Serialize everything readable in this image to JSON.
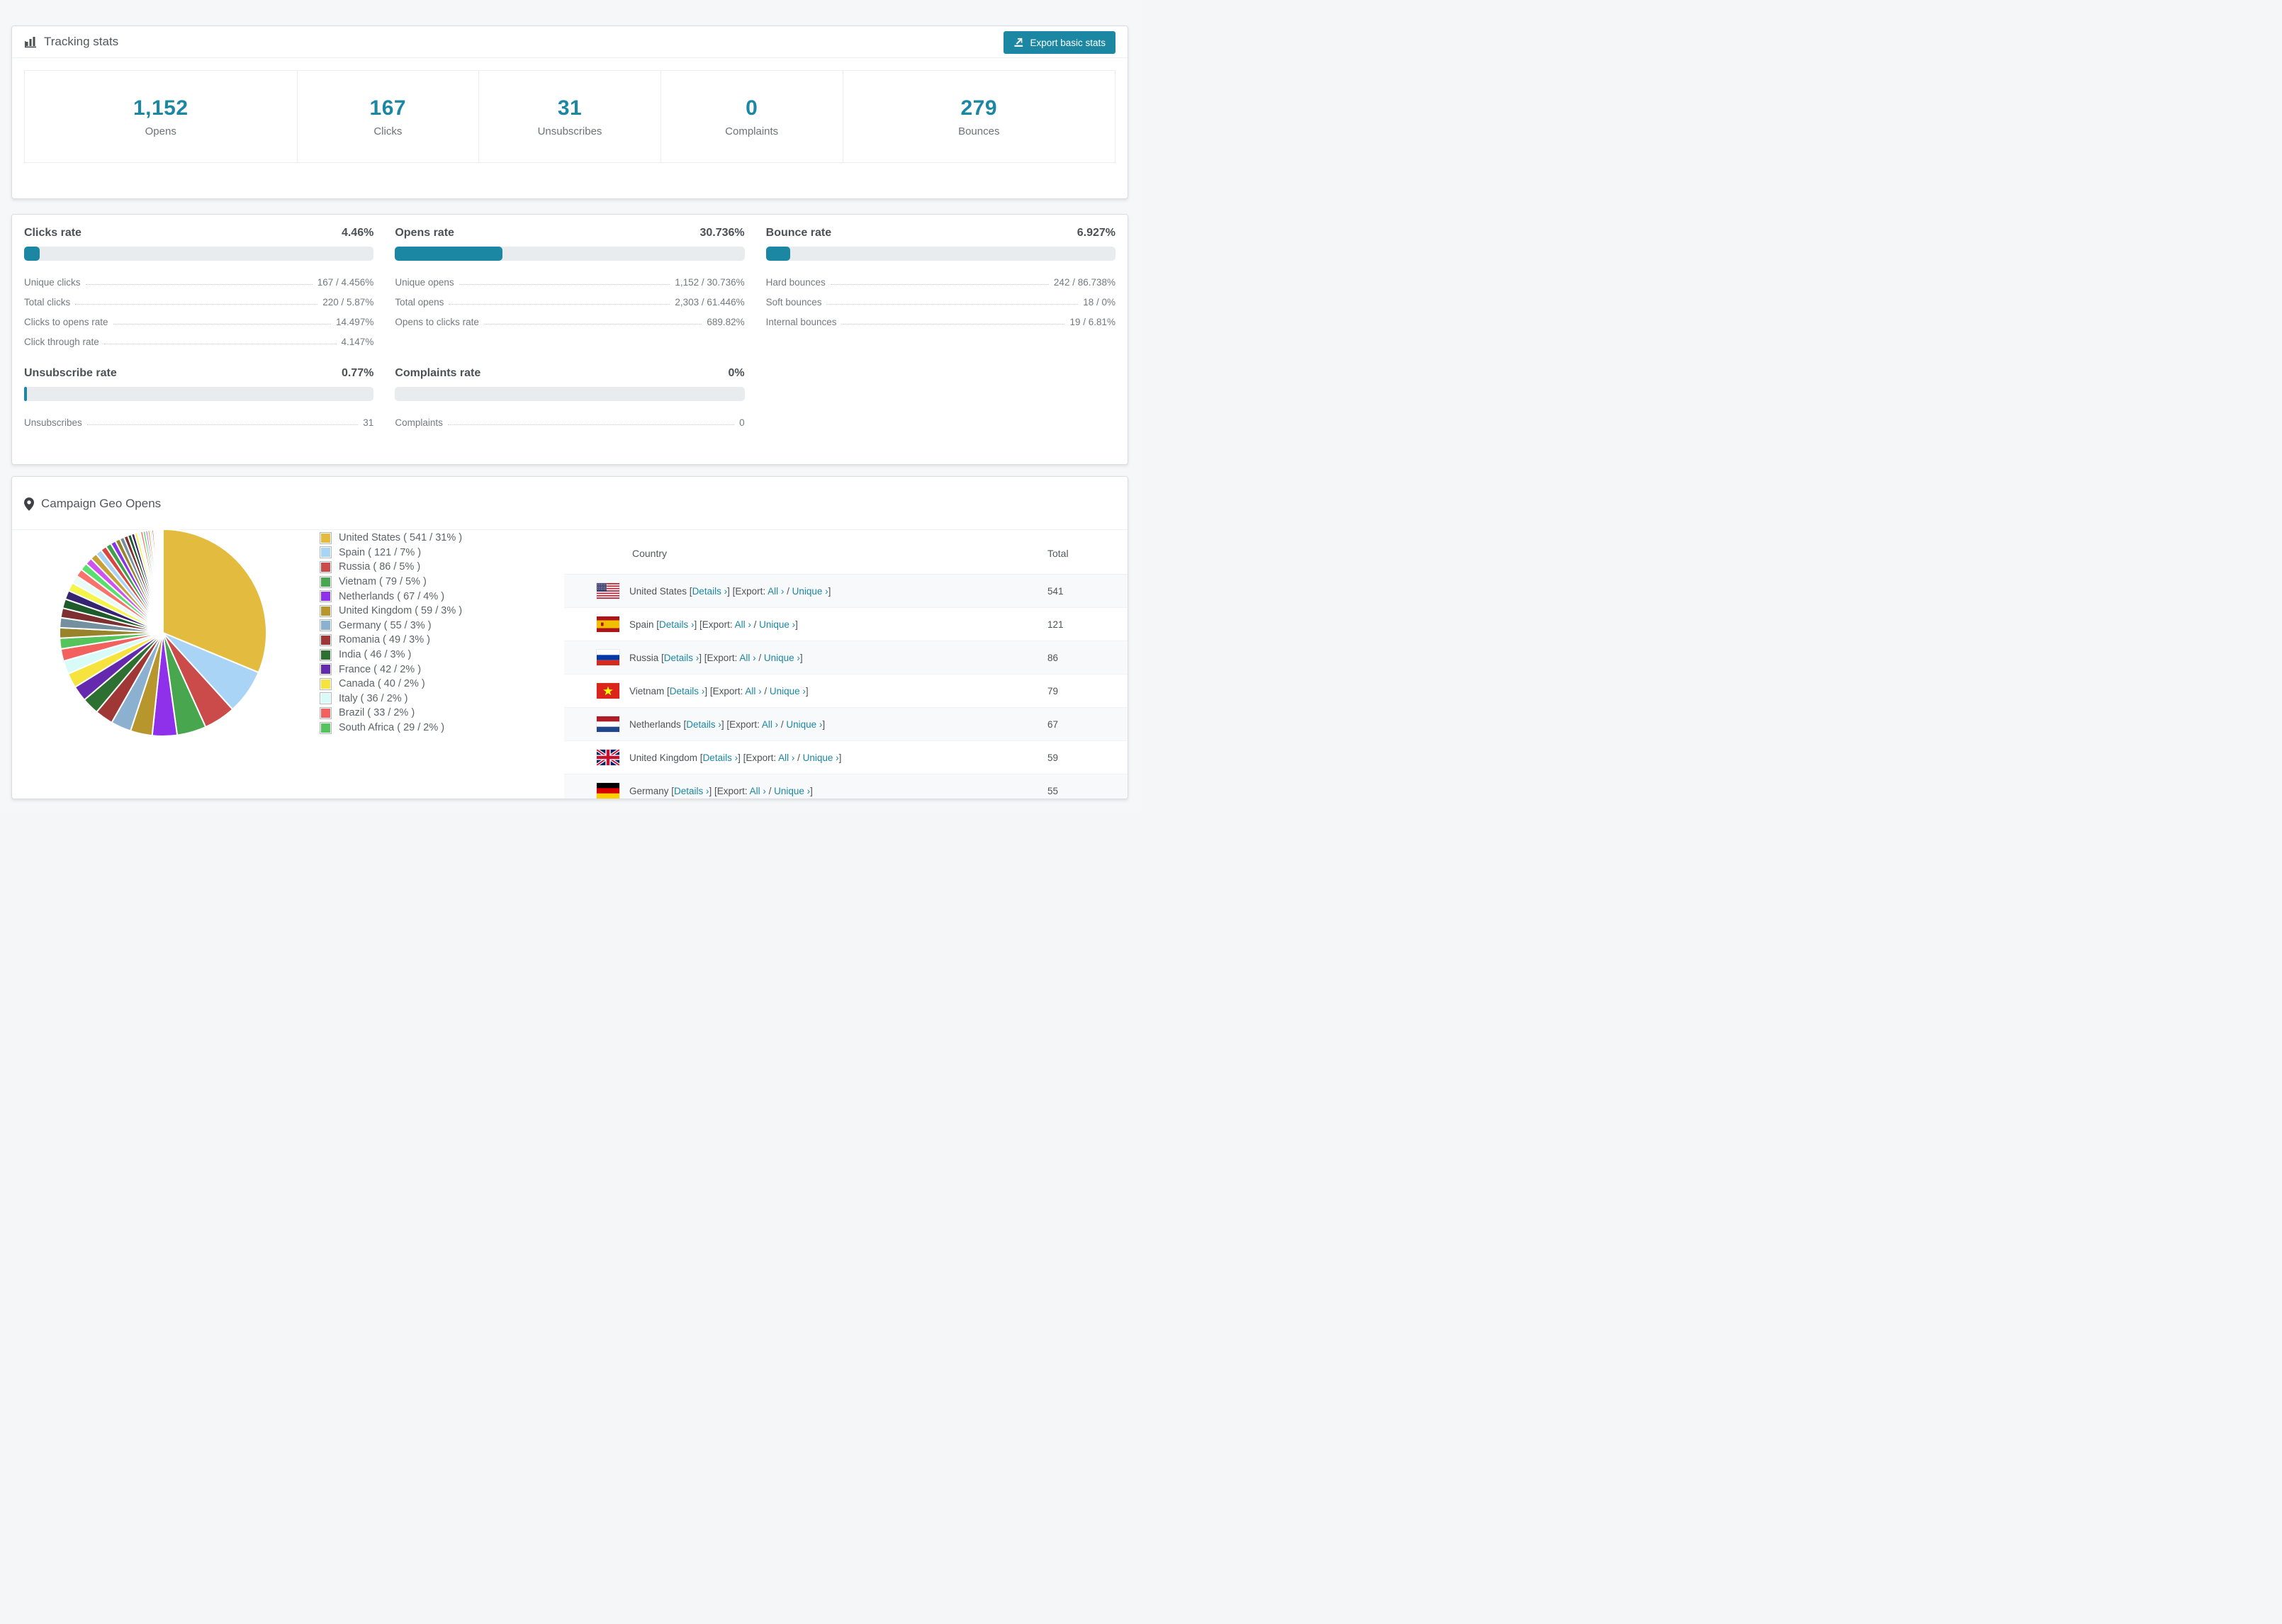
{
  "app": {
    "background": "#f6f7f8",
    "accent": "#1b87a3"
  },
  "tracking": {
    "title": "Tracking stats",
    "export_button": {
      "label": "Export basic stats"
    },
    "stats": [
      {
        "value": "1,152",
        "label": "Opens"
      },
      {
        "value": "167",
        "label": "Clicks"
      },
      {
        "value": "31",
        "label": "Unsubscribes"
      },
      {
        "value": "0",
        "label": "Complaints"
      },
      {
        "value": "279",
        "label": "Bounces"
      }
    ]
  },
  "rates": {
    "panels": [
      {
        "title": "Clicks rate",
        "value": "4.46%",
        "percent": 4.46,
        "rows": [
          {
            "label": "Unique clicks",
            "value": "167 / 4.456%"
          },
          {
            "label": "Total clicks",
            "value": "220 / 5.87%"
          },
          {
            "label": "Clicks to opens rate",
            "value": "14.497%"
          },
          {
            "label": "Click through rate",
            "value": "4.147%"
          }
        ]
      },
      {
        "title": "Opens rate",
        "value": "30.736%",
        "percent": 30.736,
        "rows": [
          {
            "label": "Unique opens",
            "value": "1,152 / 30.736%"
          },
          {
            "label": "Total opens",
            "value": "2,303 / 61.446%"
          },
          {
            "label": "Opens to clicks rate",
            "value": "689.82%"
          }
        ]
      },
      {
        "title": "Bounce rate",
        "value": "6.927%",
        "percent": 6.927,
        "rows": [
          {
            "label": "Hard bounces",
            "value": "242 / 86.738%"
          },
          {
            "label": "Soft bounces",
            "value": "18 / 0%"
          },
          {
            "label": "Internal bounces",
            "value": "19 / 6.81%"
          }
        ]
      },
      {
        "title": "Unsubscribe rate",
        "value": "0.77%",
        "percent": 0.77,
        "rows": [
          {
            "label": "Unsubscribes",
            "value": "31"
          }
        ]
      },
      {
        "title": "Complaints rate",
        "value": "0%",
        "percent": 0,
        "rows": [
          {
            "label": "Complaints",
            "value": "0"
          }
        ]
      }
    ]
  },
  "geo": {
    "title": "Campaign Geo Opens",
    "table": {
      "headers": {
        "country": "Country",
        "total": "Total"
      },
      "links": {
        "details": "Details ›",
        "export_prefix": "Export:",
        "all": "All ›",
        "unique": "Unique ›"
      },
      "rows": [
        {
          "country": "United States",
          "flag": "us",
          "total": "541"
        },
        {
          "country": "Spain",
          "flag": "es",
          "total": "121"
        },
        {
          "country": "Russia",
          "flag": "ru",
          "total": "86"
        },
        {
          "country": "Vietnam",
          "flag": "vn",
          "total": "79"
        },
        {
          "country": "Netherlands",
          "flag": "nl",
          "total": "67"
        },
        {
          "country": "United Kingdom",
          "flag": "gb",
          "total": "59"
        },
        {
          "country": "Germany",
          "flag": "de",
          "total": "55"
        }
      ]
    }
  },
  "chart_data": {
    "type": "pie",
    "title": "Campaign Geo Opens",
    "legend_position": "right",
    "start_angle": "top",
    "direction": "clockwise",
    "slices": [
      {
        "label": "United States",
        "value": 541,
        "pct": 31,
        "color": "#e3bc3f"
      },
      {
        "label": "Spain",
        "value": 121,
        "pct": 7,
        "color": "#aad4f5"
      },
      {
        "label": "Russia",
        "value": 86,
        "pct": 5,
        "color": "#cb4a4a"
      },
      {
        "label": "Vietnam",
        "value": 79,
        "pct": 5,
        "color": "#47a64e"
      },
      {
        "label": "Netherlands",
        "value": 67,
        "pct": 4,
        "color": "#8f31ea"
      },
      {
        "label": "United Kingdom",
        "value": 59,
        "pct": 3,
        "color": "#b8962e"
      },
      {
        "label": "Germany",
        "value": 55,
        "pct": 3,
        "color": "#8cb0cf"
      },
      {
        "label": "Romania",
        "value": 49,
        "pct": 3,
        "color": "#a03737"
      },
      {
        "label": "India",
        "value": 46,
        "pct": 3,
        "color": "#2e7031"
      },
      {
        "label": "France",
        "value": 42,
        "pct": 2,
        "color": "#6429ad"
      },
      {
        "label": "Canada",
        "value": 40,
        "pct": 2,
        "color": "#f7e33e"
      },
      {
        "label": "Italy",
        "value": 36,
        "pct": 2,
        "color": "#d9fbf7"
      },
      {
        "label": "Brazil",
        "value": 33,
        "pct": 2,
        "color": "#f2615e"
      },
      {
        "label": "South Africa",
        "value": 29,
        "pct": 2,
        "color": "#56c45c"
      }
    ],
    "others": {
      "values": [
        28,
        27,
        26,
        25,
        24,
        23,
        22,
        21,
        20,
        19,
        18,
        17,
        16,
        15,
        14,
        13,
        12,
        11,
        10,
        9,
        8,
        8,
        7,
        7,
        6,
        6,
        5,
        5,
        4,
        4,
        3,
        3,
        2,
        2,
        2,
        1,
        1,
        1,
        1,
        1
      ],
      "colors": [
        "#98832a",
        "#74909e",
        "#7e3030",
        "#1f5c2c",
        "#372470",
        "#f4f449",
        "#e8fbf4",
        "#f9726c",
        "#58df6d",
        "#cf53ee",
        "#c7a037",
        "#a9d2f3",
        "#d7463f",
        "#40a04e",
        "#8a36e8"
      ]
    }
  }
}
